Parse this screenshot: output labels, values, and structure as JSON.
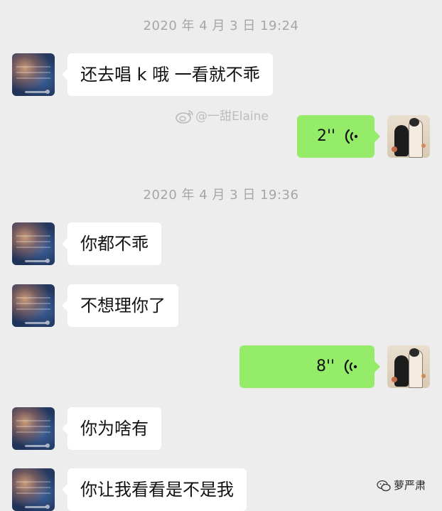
{
  "chat": {
    "timestamps": [
      "2020 年 4 月 3 日 19:24",
      "2020 年 4 月 3 日 19:36"
    ],
    "messages": [
      {
        "from": "them",
        "type": "text",
        "text": "还去唱 k 哦 一看就不乖"
      },
      {
        "from": "me",
        "type": "voice",
        "duration": "2''"
      },
      {
        "from": "them",
        "type": "text",
        "text": "你都不乖"
      },
      {
        "from": "them",
        "type": "text",
        "text": "不想理你了"
      },
      {
        "from": "me",
        "type": "voice",
        "duration": "8''"
      },
      {
        "from": "them",
        "type": "text",
        "text": "你为啥有"
      },
      {
        "from": "them",
        "type": "text",
        "text": "你让我看看是不是我"
      }
    ]
  },
  "watermarks": {
    "weibo_handle": "@一甜Elaine",
    "wechat_account": "萝严肃"
  },
  "colors": {
    "background": "#ededed",
    "incoming_bubble": "#ffffff",
    "outgoing_bubble": "#95ec69",
    "timestamp_text": "#a6a6a6"
  },
  "icons": {
    "voice": "voice-wave-icon",
    "weibo": "weibo-logo-icon",
    "wechat": "wechat-logo-icon"
  }
}
